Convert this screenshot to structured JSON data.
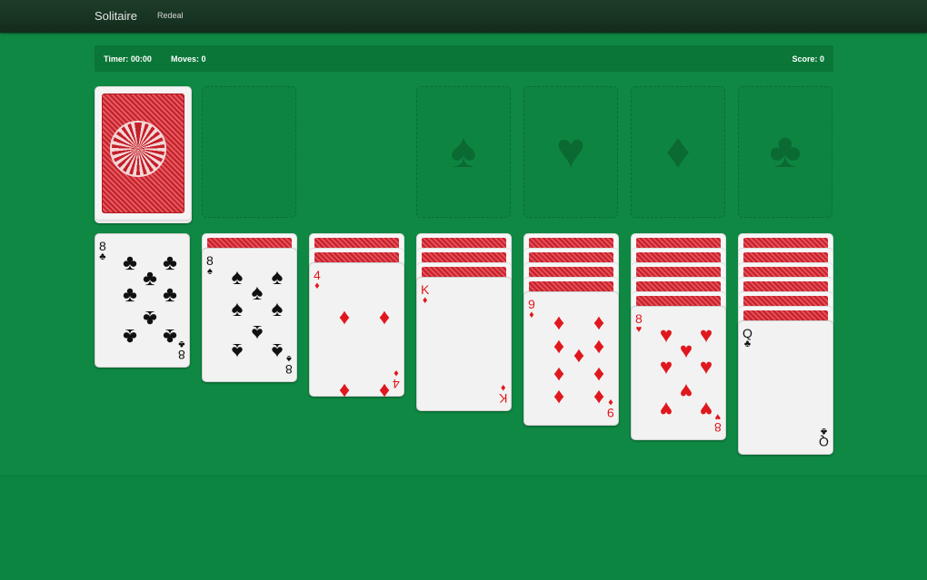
{
  "navbar": {
    "title": "Solitaire",
    "redeal_label": "Redeal"
  },
  "status": {
    "timer": "Timer: 00:00",
    "moves": "Moves: 0",
    "score": "Score: 0"
  },
  "icons": {
    "stock": "card-back-icon",
    "foundations": [
      "spade-icon",
      "heart-icon",
      "diamond-icon",
      "club-icon"
    ]
  },
  "colors": {
    "felt": "#0f8a45",
    "navbar": "#132c1c",
    "red": "#e0181e",
    "black": "#111111"
  },
  "foundations": [
    {
      "suit": "♠"
    },
    {
      "suit": "♥"
    },
    {
      "suit": "♦"
    },
    {
      "suit": "♣"
    }
  ],
  "tableau": [
    {
      "face_down": 0,
      "rank": "8",
      "suit": "♣",
      "color": "black"
    },
    {
      "face_down": 1,
      "rank": "8",
      "suit": "♠",
      "color": "black"
    },
    {
      "face_down": 2,
      "rank": "4",
      "suit": "♦",
      "color": "red"
    },
    {
      "face_down": 3,
      "rank": "K",
      "suit": "♦",
      "color": "red"
    },
    {
      "face_down": 4,
      "rank": "9",
      "suit": "♦",
      "color": "red"
    },
    {
      "face_down": 5,
      "rank": "8",
      "suit": "♥",
      "color": "red"
    },
    {
      "face_down": 6,
      "rank": "Q",
      "suit": "♣",
      "color": "black"
    }
  ]
}
